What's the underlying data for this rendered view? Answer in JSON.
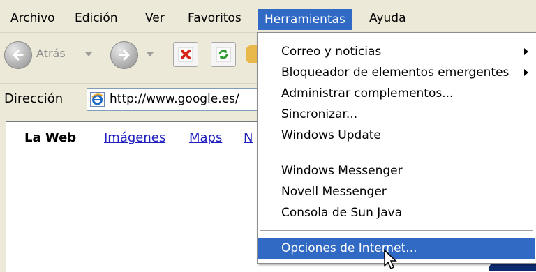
{
  "menubar": {
    "items": [
      "Archivo",
      "Edición",
      "Ver",
      "Favoritos",
      "Herramientas",
      "Ayuda"
    ],
    "active": "Herramientas"
  },
  "toolbar": {
    "back_label": "Atrás"
  },
  "address": {
    "label": "Dirección",
    "url": "http://www.google.es/"
  },
  "page": {
    "nav": [
      "La Web",
      "Imágenes",
      "Maps",
      "N"
    ]
  },
  "tools_menu": {
    "items": [
      {
        "label": "Correo y noticias",
        "submenu": true
      },
      {
        "label": "Bloqueador de elementos emergentes",
        "submenu": true
      },
      {
        "label": "Administrar complementos...",
        "submenu": false
      },
      {
        "label": "Sincronizar...",
        "submenu": false
      },
      {
        "label": "Windows Update",
        "submenu": false
      },
      {
        "label": "Windows Messenger",
        "submenu": false
      },
      {
        "label": "Novell Messenger",
        "submenu": false
      },
      {
        "label": "Consola de Sun Java",
        "submenu": false
      },
      {
        "label": "Opciones de Internet...",
        "submenu": false,
        "highlighted": true
      }
    ]
  },
  "colors": {
    "highlight": "#316ac5",
    "chrome": "#ece9d8",
    "link": "#2020c0"
  }
}
